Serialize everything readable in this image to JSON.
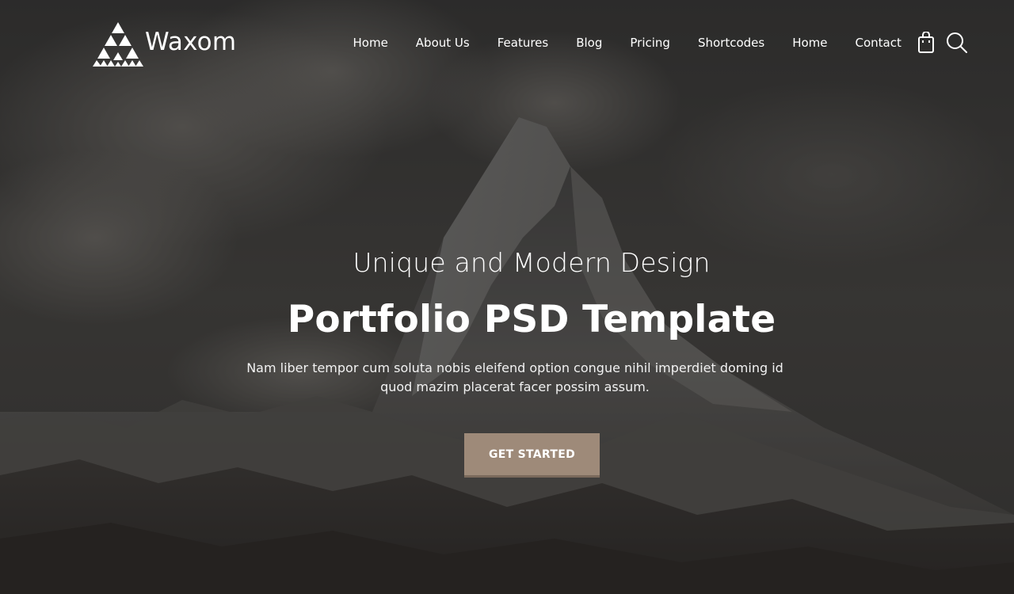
{
  "brand": {
    "name": "Waxom"
  },
  "nav": {
    "items": [
      {
        "label": "Home"
      },
      {
        "label": "About Us"
      },
      {
        "label": "Features"
      },
      {
        "label": "Blog"
      },
      {
        "label": "Pricing"
      },
      {
        "label": "Shortcodes"
      },
      {
        "label": "Home"
      },
      {
        "label": "Contact"
      }
    ],
    "icons": [
      "shopping-bag-icon",
      "search-icon"
    ]
  },
  "hero": {
    "subtitle": "Unique and Modern Design",
    "title": "Portfolio PSD Template",
    "description": "Nam liber tempor cum soluta nobis eleifend option congue nihil imperdiet doming id quod mazim placerat facer possim assum.",
    "cta_label": "GET STARTED"
  },
  "colors": {
    "accent": "#9e8a79",
    "overlay": "#2e2d2b",
    "text": "#ffffff"
  }
}
